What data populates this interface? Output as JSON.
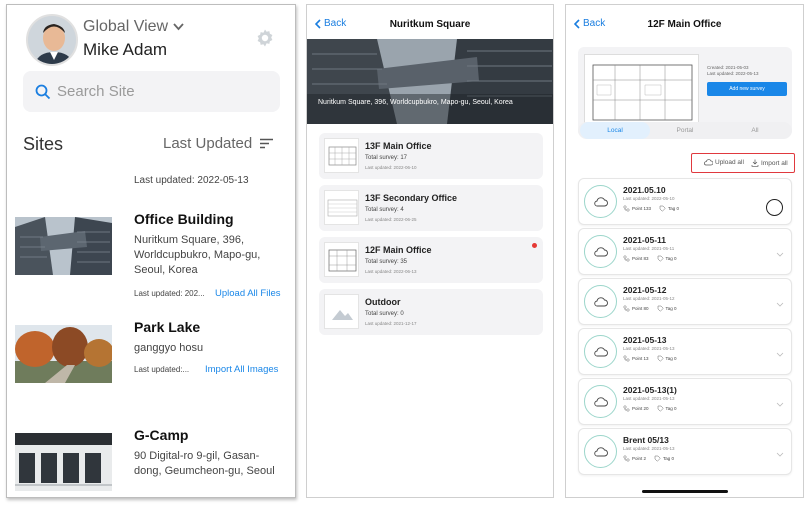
{
  "screen1": {
    "view_title": "Global View",
    "user_name": "Mike Adam",
    "search_placeholder": "Search Site",
    "sites_title": "Sites",
    "sort_label": "Last Updated",
    "last_updated_top": "Last updated: 2022-05-13",
    "sites": [
      {
        "name": "Office Building",
        "address": "Nuritkum Square, 396, Worldcupbukro, Mapo-gu, Seoul, Korea",
        "meta": "Last updated: 202...",
        "action": "Upload All Files"
      },
      {
        "name": "Park Lake",
        "address": "ganggyo hosu",
        "meta": "Last updated:...",
        "action": "Import All Images"
      },
      {
        "name": "G-Camp",
        "address": "90 Digital-ro 9-gil, Gasan-dong, Geumcheon-gu, Seoul",
        "meta": "",
        "action": ""
      }
    ]
  },
  "screen2": {
    "back_label": "Back",
    "title": "Nuritkum Square",
    "hero_address": "Nuritkum Square, 396, Worldcupbukro, Mapo-gu, Seoul, Korea",
    "floors": [
      {
        "name": "13F Main Office",
        "count": "Total survey: 17",
        "date": "Last updated: 2022-06-10"
      },
      {
        "name": "13F Secondary Office",
        "count": "Total survey: 4",
        "date": "Last updated: 2022-06-25"
      },
      {
        "name": "12F Main Office",
        "count": "Total survey: 35",
        "date": "Last updated: 2022-06-13"
      },
      {
        "name": "Outdoor",
        "count": "Total survey: 0",
        "date": "Last updated: 2021-12-17"
      }
    ]
  },
  "screen3": {
    "back_label": "Back",
    "title": "12F Main Office",
    "created": "Created: 2021-05-03",
    "updated": "Last updated: 2022-05-13",
    "add_survey": "Add new survey",
    "tabs": [
      "Local",
      "Portal",
      "All"
    ],
    "upload_all": "Upload all",
    "import_all": "Import all",
    "surveys": [
      {
        "name": "2021.05.10",
        "date": "Last updated: 2022-05-10",
        "points": "Point 133",
        "tag": "Tag 0"
      },
      {
        "name": "2021-05-11",
        "date": "Last updated: 2021-05-11",
        "points": "Point 83",
        "tag": "Tag 0"
      },
      {
        "name": "2021-05-12",
        "date": "Last updated: 2021-05-12",
        "points": "Point 80",
        "tag": "Tag 0"
      },
      {
        "name": "2021-05-13",
        "date": "Last updated: 2021-05-13",
        "points": "Point 13",
        "tag": "Tag 0"
      },
      {
        "name": "2021-05-13(1)",
        "date": "Last updated: 2021-05-13",
        "points": "Point 20",
        "tag": "Tag 0"
      },
      {
        "name": "Brent 05/13",
        "date": "Last updated: 2021-05-13",
        "points": "Point 2",
        "tag": "Tag 0"
      }
    ]
  },
  "colors": {
    "accent": "#1a87e8",
    "teal": "#9cd6cb",
    "alert": "#e0393e"
  }
}
